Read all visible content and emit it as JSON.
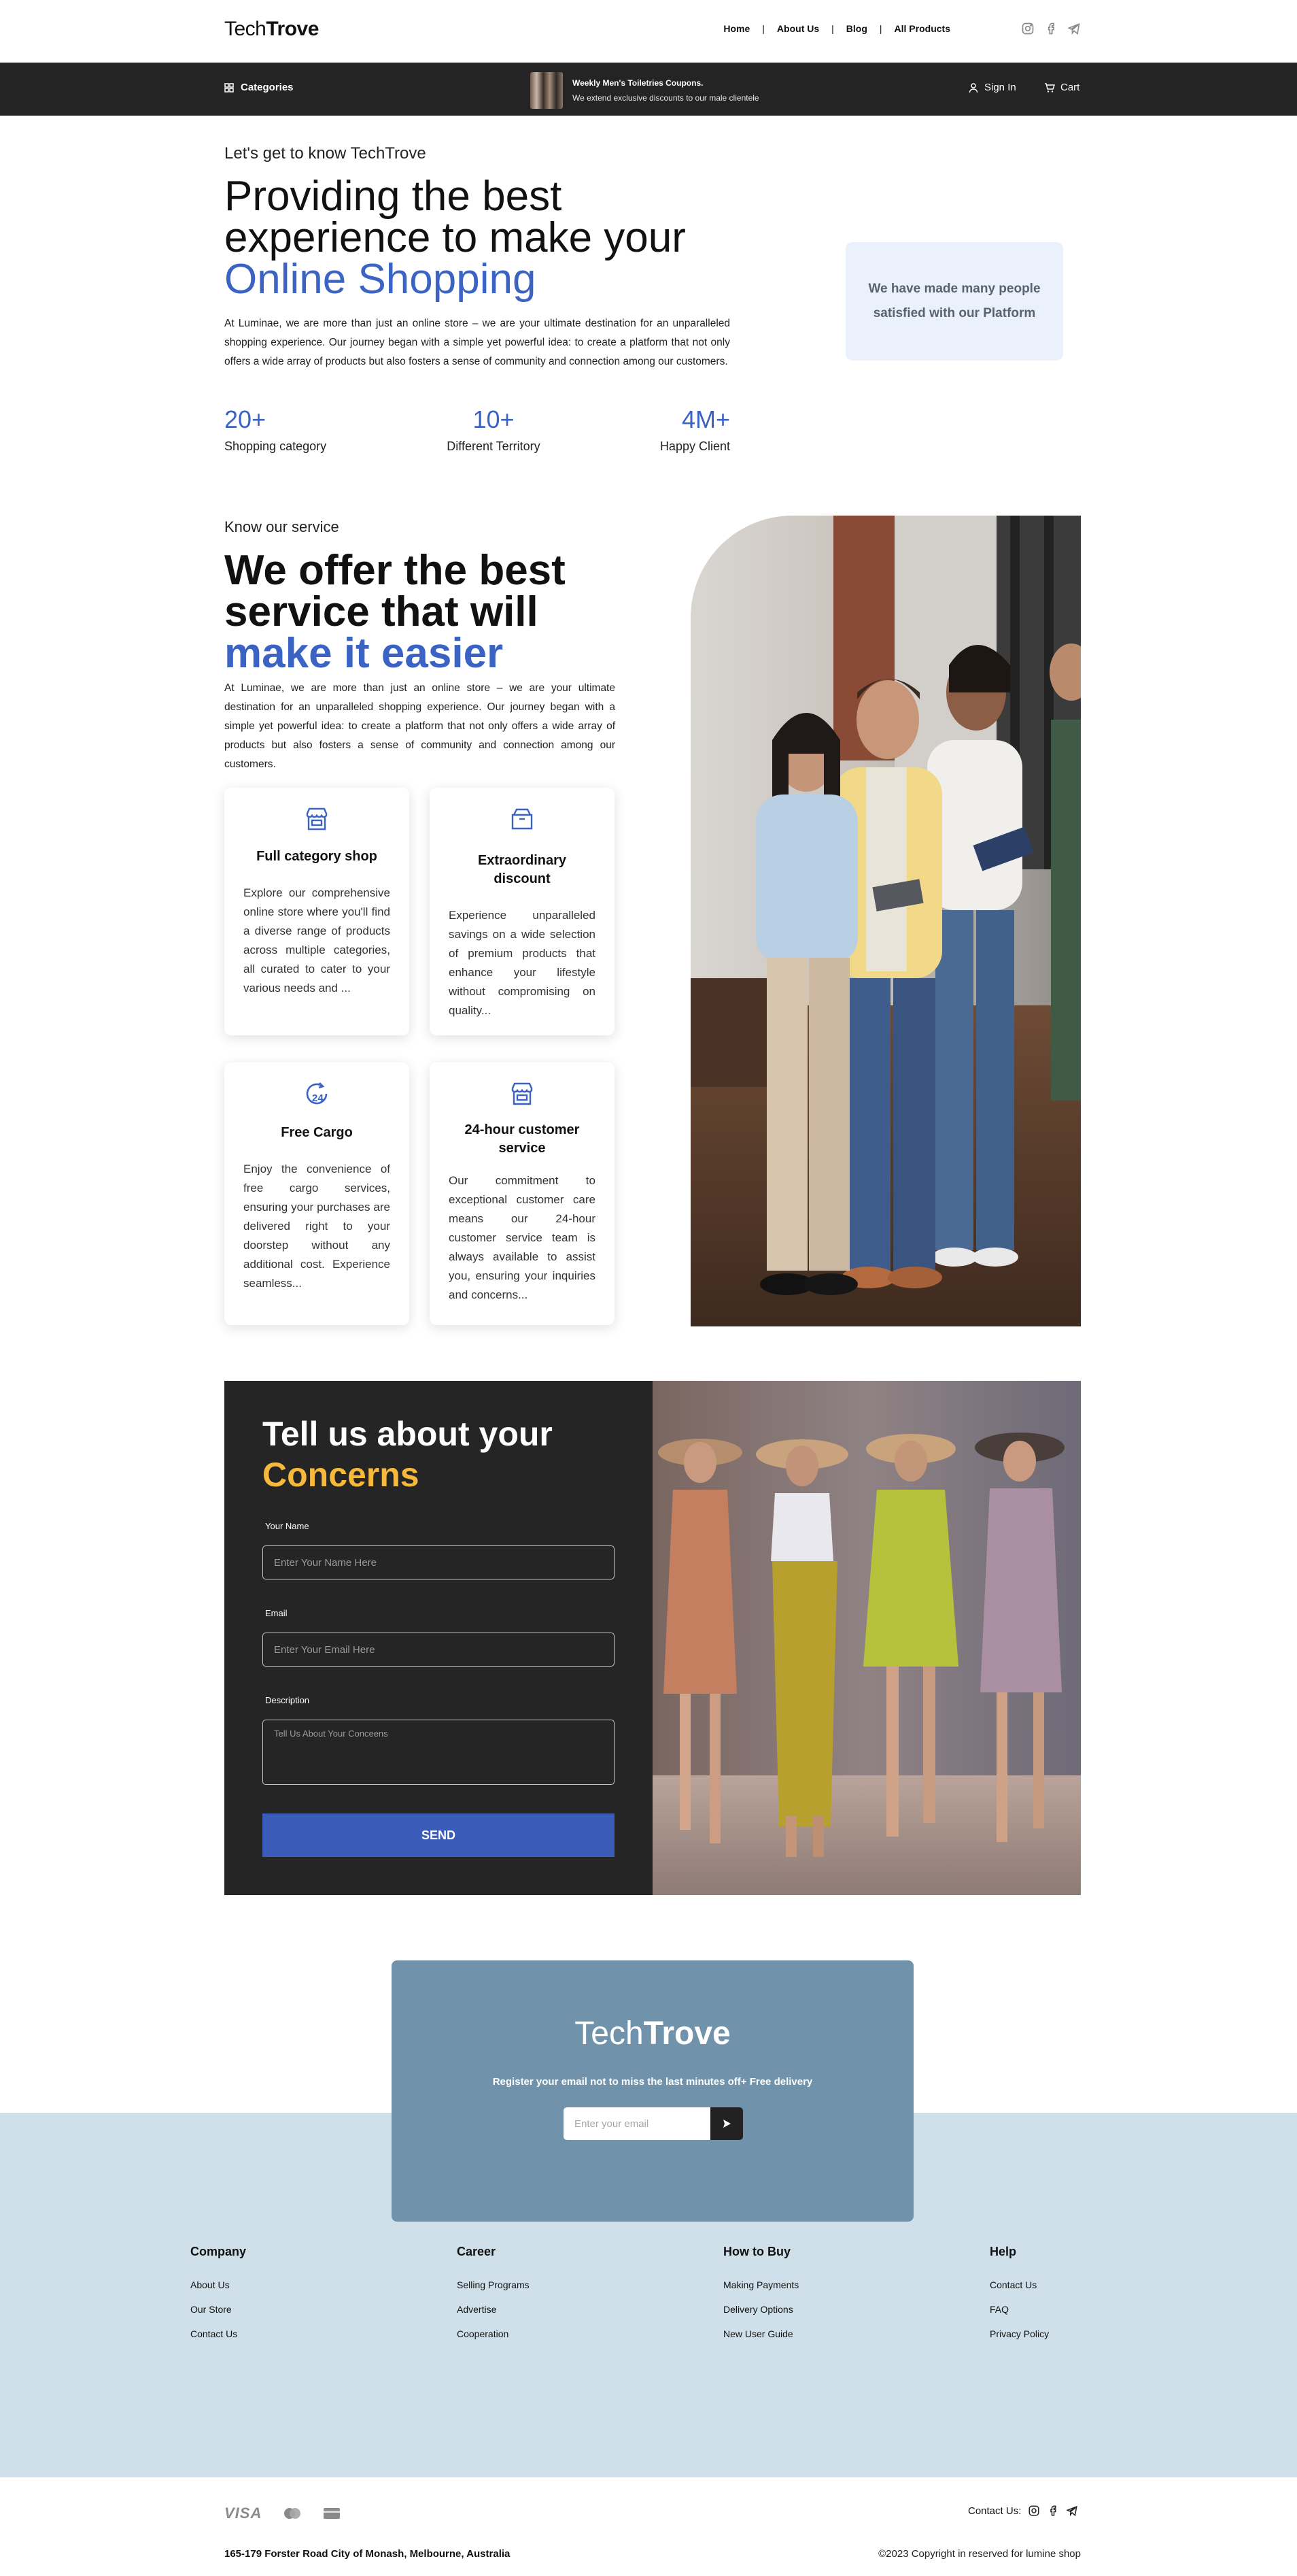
{
  "header": {
    "logo_light": "Tech",
    "logo_bold": "Trove",
    "nav": [
      "Home",
      "About Us",
      "Blog",
      "All Products"
    ],
    "separator": "|",
    "social_icons": [
      "instagram-icon",
      "facebook-icon",
      "telegram-icon"
    ]
  },
  "topbar": {
    "categories_label": "Categories",
    "promo_title": "Weekly Men's Toiletries Coupons.",
    "promo_subtitle": "We extend exclusive discounts to our male clientele",
    "signin_label": "Sign In",
    "cart_label": "Cart"
  },
  "about": {
    "kicker": "Let's get to know TechTrove",
    "heading_line1": "Providing the best",
    "heading_line2": "experience to make your",
    "heading_accent": "Online Shopping",
    "paragraph": "At Luminae, we are more than just an online store – we are your ultimate destination for an unparalleled shopping experience. Our journey began with a simple yet powerful idea: to create a platform that not only offers a wide array of products but also fosters a sense of community and connection among our customers.",
    "stats": [
      {
        "value": "20+",
        "label": "Shopping category"
      },
      {
        "value": "10+",
        "label": "Different Territory"
      },
      {
        "value": "4M+",
        "label": "Happy Client"
      }
    ],
    "card_text": "We have made many people satisfied with our Platform"
  },
  "services": {
    "kicker": "Know our service",
    "heading_line1": "We offer the best",
    "heading_line2": "service that will",
    "heading_accent": "make it easier",
    "paragraph": "At Luminae, we are more than just an online store – we are your ultimate destination for an unparalleled shopping experience. Our journey began with a simple yet powerful idea: to create a platform that not only offers a wide array of products but also fosters a sense of community and connection among our customers.",
    "cards": [
      {
        "icon": "store-icon",
        "title": "Full category shop",
        "desc": "Explore our comprehensive online store where you'll find a diverse range of products across multiple categories, all curated to cater to your various needs and ..."
      },
      {
        "icon": "shopping-bag-icon",
        "title": "Extraordinary discount",
        "desc": "Experience unparalleled savings on a wide selection of premium products that enhance your lifestyle without compromising on quality..."
      },
      {
        "icon": "clock-24-icon",
        "title": "Free Cargo",
        "desc": "Enjoy the convenience of free cargo services, ensuring your purchases are delivered right to your doorstep without any additional cost. Experience seamless..."
      },
      {
        "icon": "store-icon",
        "title": "24-hour customer service",
        "desc": "Our commitment to exceptional customer care means our 24-hour customer service team is always available to assist you, ensuring your inquiries and concerns..."
      }
    ]
  },
  "concerns": {
    "heading_line1": "Tell us about your",
    "heading_accent": "Concerns",
    "name_label": "Your Name",
    "name_placeholder": "Enter Your Name Here",
    "email_label": "Email",
    "email_placeholder": "Enter Your Email Here",
    "desc_label": "Description",
    "desc_placeholder": "Tell Us About Your Conceens",
    "send_label": "SEND"
  },
  "newsletter": {
    "logo_light": "Tech",
    "logo_bold": "Trove",
    "text": "Register your email not to miss the last minutes off+ Free delivery",
    "placeholder": "Enter your email"
  },
  "footer": {
    "columns": [
      {
        "title": "Company",
        "links": [
          "About Us",
          "Our Store",
          "Contact Us"
        ]
      },
      {
        "title": "Career",
        "links": [
          "Selling Programs",
          "Advertise",
          "Cooperation"
        ]
      },
      {
        "title": "How to Buy",
        "links": [
          "Making Payments",
          "Delivery Options",
          "New User Guide"
        ]
      },
      {
        "title": "Help",
        "links": [
          "Contact Us",
          "FAQ",
          "Privacy Policy"
        ]
      }
    ],
    "payment_visa": "VISA",
    "contact_label": "Contact Us:",
    "address": "165-179 Forster Road City of Monash, Melbourne, Australia",
    "copyright": "©2023 Copyright in reserved for lumine shop"
  },
  "colors": {
    "accent_blue": "#3a63c4",
    "accent_yellow": "#f6b93b",
    "dark_bar": "#242424",
    "newsletter_bg": "#7093ab",
    "footer_bg": "#d0e0ea"
  }
}
